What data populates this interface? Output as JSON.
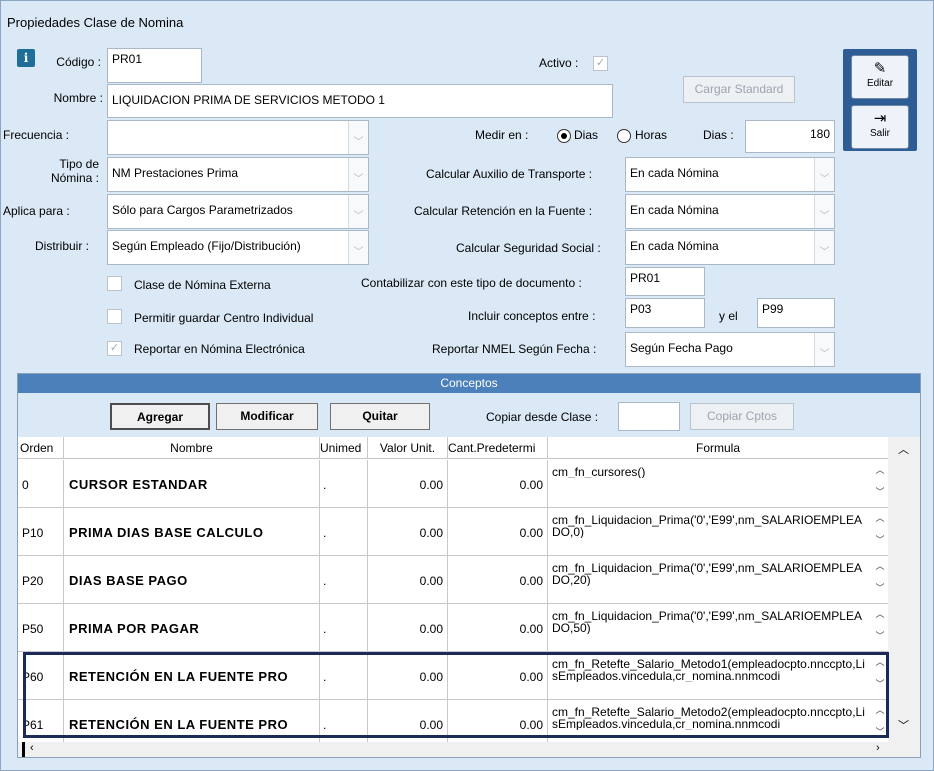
{
  "window": {
    "title": "Propiedades Clase de Nomina"
  },
  "form": {
    "codigo_label": "Código :",
    "codigo_value": "PR01",
    "activo_label": "Activo :",
    "activo_check": "✓",
    "nombre_label": "Nombre :",
    "nombre_value": "LIQUIDACION PRIMA DE SERVICIOS METODO 1",
    "cargar_standard_label": "Cargar Standard",
    "frecuencia_label": "Frecuencia :",
    "frecuencia_value": "",
    "medir_en_label": "Medir en :",
    "medir_dias_label": "Dias",
    "medir_horas_label": "Horas",
    "medir_selected": "Dias",
    "dias_label": "Dias :",
    "dias_value": "180",
    "tipo_nomina_label_1": "Tipo de",
    "tipo_nomina_label_2": "Nómina :",
    "tipo_nomina_value": "NM Prestaciones Prima",
    "auxilio_label": "Calcular Auxilio de Transporte :",
    "auxilio_value": "En cada Nómina",
    "aplica_label": "Aplica para :",
    "aplica_value": "Sólo para Cargos Parametrizados",
    "retencion_label": "Calcular Retención en la Fuente :",
    "retencion_value": "En cada Nómina",
    "distribuir_label": "Distribuir :",
    "distribuir_value": "Según Empleado (Fijo/Distribución)",
    "seguridad_label": "Calcular Seguridad Social :",
    "seguridad_value": "En cada Nómina",
    "clase_externa_label": "Clase de Nómina Externa",
    "contabilizar_label": "Contabilizar con este tipo de documento :",
    "contabilizar_value": "PR01",
    "permitir_label": "Permitir guardar Centro Individual",
    "incluir_label": "Incluir conceptos entre :",
    "incluir_desde": "P03",
    "incluir_y_label": "y el",
    "incluir_hasta": "P99",
    "reportar_label": "Reportar en Nómina Electrónica",
    "reportar_check": "✓",
    "nmel_label": "Reportar NMEL Según Fecha :",
    "nmel_value": "Según Fecha Pago"
  },
  "side": {
    "editar": "Editar",
    "salir": "Salir"
  },
  "conceptos": {
    "title": "Conceptos",
    "agregar": "Agregar",
    "modificar": "Modificar",
    "quitar": "Quitar",
    "copiar_label": "Copiar desde Clase :",
    "copiar_value": "",
    "copiar_btn": "Copiar Cptos",
    "headers": {
      "orden": "Orden",
      "nombre": "Nombre",
      "unimed": "Unimed",
      "valor": "Valor Unit.",
      "cant": "Cant.Predetermi",
      "formula": "Formula"
    },
    "rows": [
      {
        "orden": "0",
        "nombre": "CURSOR ESTANDAR",
        "unimed": ".",
        "valor": "0.00",
        "cant": "0.00",
        "formula": "cm_fn_cursores()"
      },
      {
        "orden": "P10",
        "nombre": "PRIMA DIAS BASE CALCULO",
        "unimed": ".",
        "valor": "0.00",
        "cant": "0.00",
        "formula": "cm_fn_Liquidacion_Prima('0','E99',nm_SALARIOEMPLEADO,0)"
      },
      {
        "orden": "P20",
        "nombre": "DIAS BASE PAGO",
        "unimed": ".",
        "valor": "0.00",
        "cant": "0.00",
        "formula": "cm_fn_Liquidacion_Prima('0','E99',nm_SALARIOEMPLEADO,20)"
      },
      {
        "orden": "P50",
        "nombre": "PRIMA POR PAGAR",
        "unimed": ".",
        "valor": "0.00",
        "cant": "0.00",
        "formula": "cm_fn_Liquidacion_Prima('0','E99',nm_SALARIOEMPLEADO,50)"
      },
      {
        "orden": "P60",
        "nombre": "RETENCIÓN EN LA FUENTE PRO",
        "unimed": ".",
        "valor": "0.00",
        "cant": "0.00",
        "formula": "cm_fn_Retefte_Salario_Metodo1(empleadocpto.nnccpto,LisEmpleados.vincedula,cr_nomina.nnmcodi"
      },
      {
        "orden": "P61",
        "nombre": "RETENCIÓN EN LA FUENTE PRO",
        "unimed": ".",
        "valor": "0.00",
        "cant": "0.00",
        "formula": "cm_fn_Retefte_Salario_Metodo2(empleadocpto.nnccpto,LisEmpleados.vincedula,cr_nomina.nnmcodi"
      }
    ]
  },
  "colors": {
    "title_bar": "#4c80bb",
    "side_col": "#2e5c94",
    "highlight": "#1b2a57",
    "background": "#dbe8f5"
  }
}
